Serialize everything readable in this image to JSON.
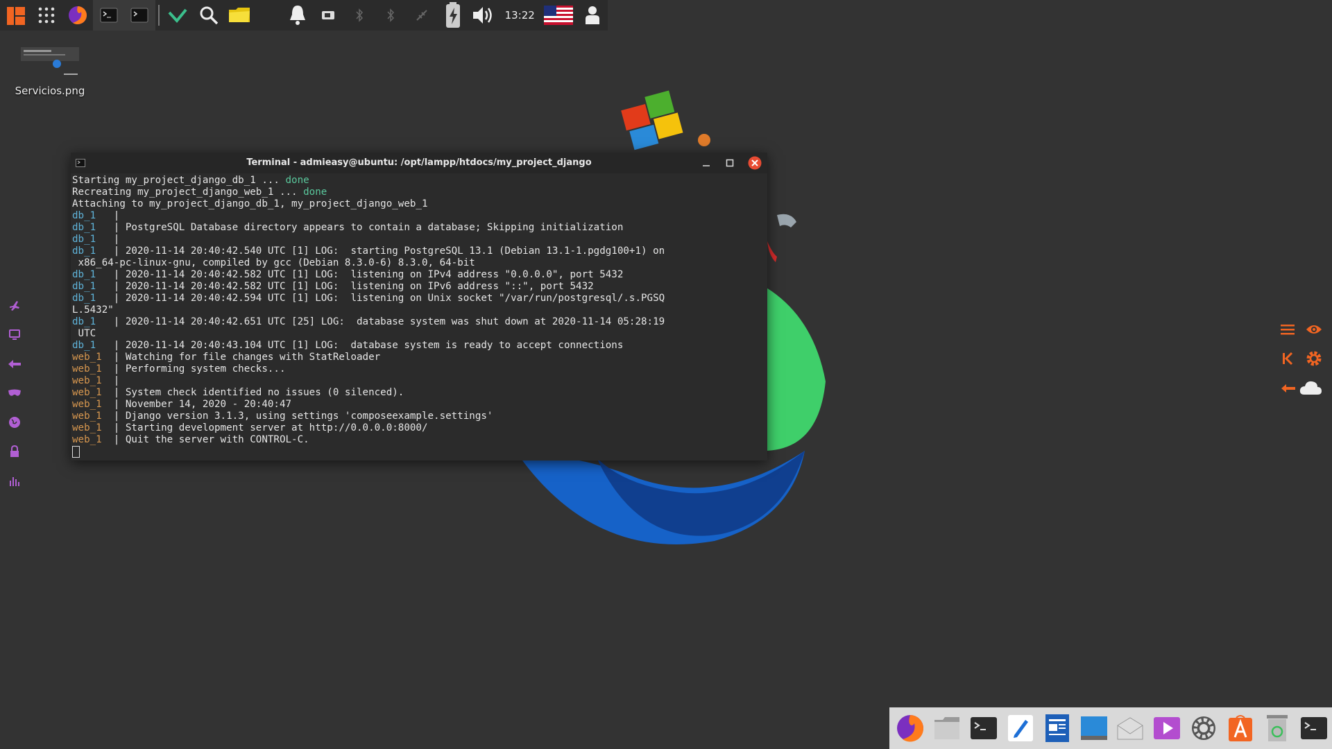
{
  "top_panel": {
    "icons": [
      "apps-menu-icon",
      "app-grid-icon",
      "firefox-icon",
      "terminal-icon",
      "terminal-icon-2",
      "check-icon",
      "search-icon",
      "folder-icon",
      "bell-icon",
      "battery-small-icon",
      "bluetooth-icon",
      "bluetooth-icon-2",
      "network-icon",
      "battery-charging-icon",
      "volume-icon",
      "us-flag-icon",
      "user-icon"
    ],
    "clock": "13:22"
  },
  "desktop": {
    "icon_label": "Servicios.png"
  },
  "terminal": {
    "title": "Terminal - admieasy@ubuntu: /opt/lampp/htdocs/my_project_django",
    "lines": [
      {
        "prefix": "",
        "text": "Starting my_project_django_db_1 ... ",
        "suffix": "done"
      },
      {
        "prefix": "",
        "text": "Recreating my_project_django_web_1 ... ",
        "suffix": "done"
      },
      {
        "prefix": "",
        "text": "Attaching to my_project_django_db_1, my_project_django_web_1",
        "suffix": ""
      },
      {
        "prefix": "db_1   ",
        "text": "| ",
        "suffix": ""
      },
      {
        "prefix": "db_1   ",
        "text": "| PostgreSQL Database directory appears to contain a database; Skipping initialization",
        "suffix": ""
      },
      {
        "prefix": "db_1   ",
        "text": "| ",
        "suffix": ""
      },
      {
        "prefix": "db_1   ",
        "text": "| 2020-11-14 20:40:42.540 UTC [1] LOG:  starting PostgreSQL 13.1 (Debian 13.1-1.pgdg100+1) on",
        "suffix": ""
      },
      {
        "prefix": "",
        "text": " x86_64-pc-linux-gnu, compiled by gcc (Debian 8.3.0-6) 8.3.0, 64-bit",
        "suffix": ""
      },
      {
        "prefix": "db_1   ",
        "text": "| 2020-11-14 20:40:42.582 UTC [1] LOG:  listening on IPv4 address \"0.0.0.0\", port 5432",
        "suffix": ""
      },
      {
        "prefix": "db_1   ",
        "text": "| 2020-11-14 20:40:42.582 UTC [1] LOG:  listening on IPv6 address \"::\", port 5432",
        "suffix": ""
      },
      {
        "prefix": "db_1   ",
        "text": "| 2020-11-14 20:40:42.594 UTC [1] LOG:  listening on Unix socket \"/var/run/postgresql/.s.PGSQ",
        "suffix": ""
      },
      {
        "prefix": "",
        "text": "L.5432\"",
        "suffix": ""
      },
      {
        "prefix": "db_1   ",
        "text": "| 2020-11-14 20:40:42.651 UTC [25] LOG:  database system was shut down at 2020-11-14 05:28:19",
        "suffix": ""
      },
      {
        "prefix": "",
        "text": " UTC",
        "suffix": ""
      },
      {
        "prefix": "db_1   ",
        "text": "| 2020-11-14 20:40:43.104 UTC [1] LOG:  database system is ready to accept connections",
        "suffix": ""
      },
      {
        "prefix": "web_1  ",
        "text": "| Watching for file changes with StatReloader",
        "suffix": ""
      },
      {
        "prefix": "web_1  ",
        "text": "| Performing system checks...",
        "suffix": ""
      },
      {
        "prefix": "web_1  ",
        "text": "| ",
        "suffix": ""
      },
      {
        "prefix": "web_1  ",
        "text": "| System check identified no issues (0 silenced).",
        "suffix": ""
      },
      {
        "prefix": "web_1  ",
        "text": "| November 14, 2020 - 20:40:47",
        "suffix": ""
      },
      {
        "prefix": "web_1  ",
        "text": "| Django version 3.1.3, using settings 'composeexample.settings'",
        "suffix": ""
      },
      {
        "prefix": "web_1  ",
        "text": "| Starting development server at http://0.0.0.0:8000/",
        "suffix": ""
      },
      {
        "prefix": "web_1  ",
        "text": "| Quit the server with CONTROL-C.",
        "suffix": ""
      }
    ]
  },
  "left_dock": [
    "airplane-icon",
    "monitor-icon",
    "arrow-left-icon",
    "mask-icon",
    "globe-icon",
    "lock-icon",
    "bar-chart-icon"
  ],
  "right_widgets": [
    "menu-icon",
    "eye-icon",
    "skip-back-icon",
    "gear-icon",
    "arrow-left-icon",
    "cloud-icon"
  ],
  "bottom_dock": [
    "firefox-icon",
    "files-icon",
    "terminal-icon",
    "text-editor-icon",
    "document-viewer-icon",
    "desktop-icon",
    "mail-icon",
    "media-player-icon",
    "settings-icon",
    "software-center-icon",
    "trash-icon",
    "terminal-icon-2"
  ],
  "colors": {
    "accent": "#f26522",
    "desktop": "#333333",
    "db_prefix": "#5fb3d9",
    "web_prefix": "#d9984f",
    "done": "#5ac79c",
    "left_dock": "#b15fd4"
  }
}
